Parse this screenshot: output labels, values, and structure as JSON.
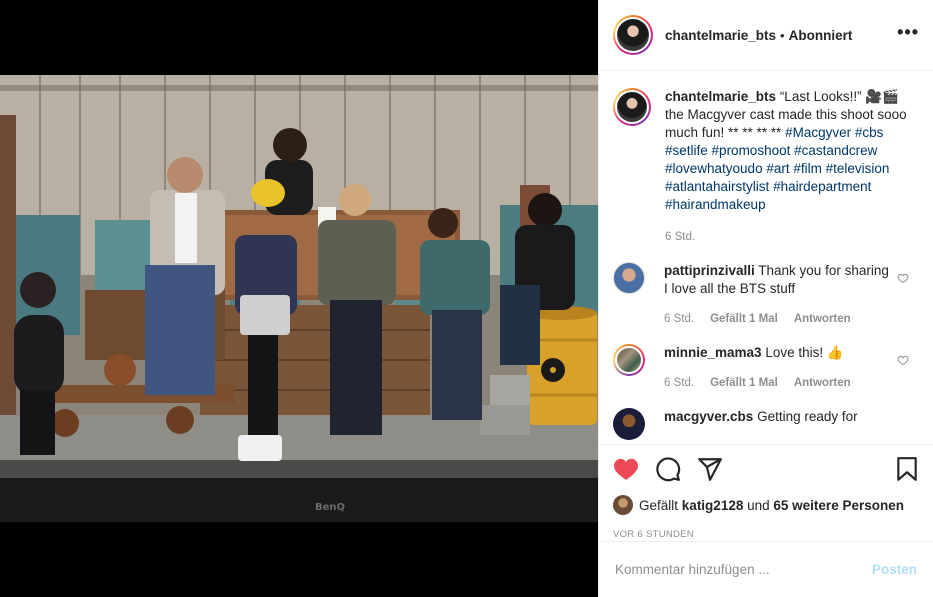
{
  "header": {
    "username": "chantelmarie_bts",
    "separator": "•",
    "follow_state": "Abonniert",
    "more_icon": "more-options-icon"
  },
  "caption": {
    "username": "chantelmarie_bts",
    "text_before": "“Last Looks!!” 🎥🎬 the Macgyver cast made this shoot sooo much fun! ** ** ** ** ",
    "hashtags": [
      "#Macgyver",
      "#cbs",
      "#setlife",
      "#promoshoot",
      "#castandcrew",
      "#lovewhatyoudo",
      "#art",
      "#film",
      "#television",
      "#atlantahairstylist",
      "#hairdepartment",
      "#hairandmakeup"
    ],
    "time": "6 Std."
  },
  "comments": [
    {
      "username": "pattiprinzivalli",
      "text": "Thank you for sharing I love all the BTS stuff",
      "time": "6 Std.",
      "likes": "Gefällt 1 Mal",
      "reply": "Antworten"
    },
    {
      "username": "minnie_mama3",
      "text": "Love this! 👍",
      "time": "6 Std.",
      "likes": "Gefällt 1 Mal",
      "reply": "Antworten"
    },
    {
      "username": "macgyver.cbs",
      "text": "Getting ready for",
      "time": "",
      "likes": "",
      "reply": ""
    }
  ],
  "actions": {
    "like_icon": "heart-filled-icon",
    "comment_icon": "comment-icon",
    "share_icon": "share-icon",
    "save_icon": "bookmark-icon",
    "like_color": "#ed4956"
  },
  "likes": {
    "prefix": "Gefällt",
    "user": "katig2128",
    "connector": "und",
    "others": "65 weitere Personen"
  },
  "time_ago": "VOR 6 STUNDEN",
  "add_comment": {
    "placeholder": "Kommentar hinzufügen ...",
    "post_label": "Posten"
  },
  "photo": {
    "watermark": "BenQ"
  }
}
